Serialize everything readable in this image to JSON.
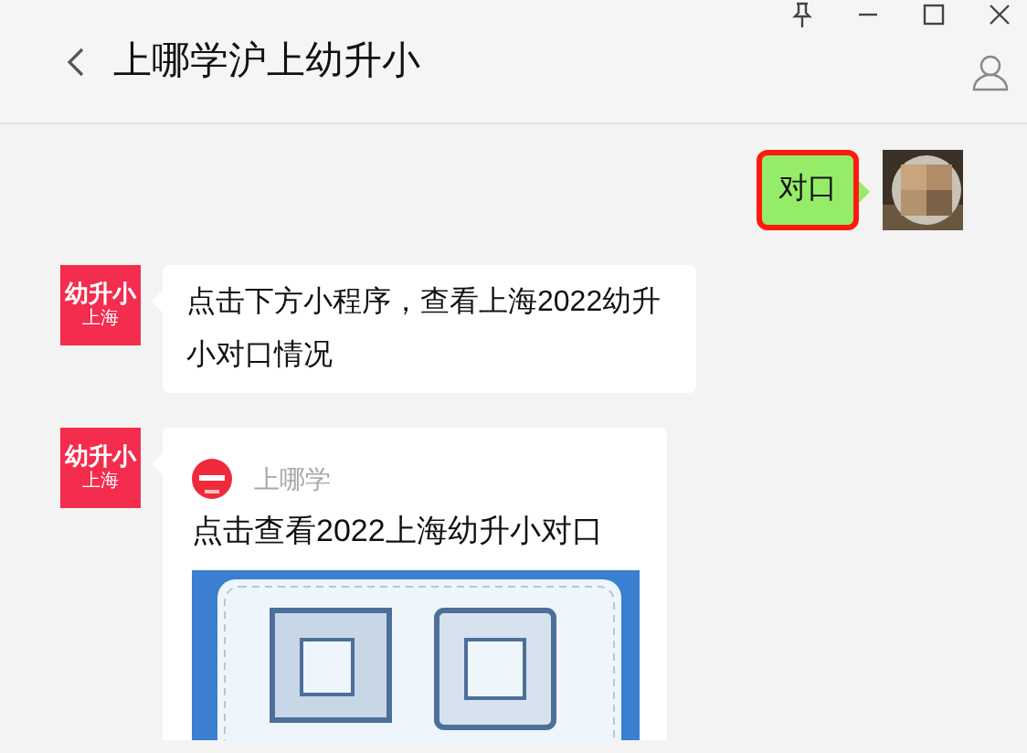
{
  "window": {
    "title": "上哪学沪上幼升小"
  },
  "messages": [
    {
      "kind": "text",
      "outgoing": true,
      "text": "对口",
      "highlighted": true
    },
    {
      "kind": "text",
      "outgoing": false,
      "avatar": {
        "name": "幼升小",
        "sub": "上海"
      },
      "text": "点击下方小程序，查看上海2022幼升小对口情况"
    },
    {
      "kind": "card",
      "outgoing": false,
      "avatar": {
        "name": "幼升小",
        "sub": "上海"
      },
      "source": "上哪学",
      "title": "点击查看2022上海幼升小对口"
    }
  ]
}
